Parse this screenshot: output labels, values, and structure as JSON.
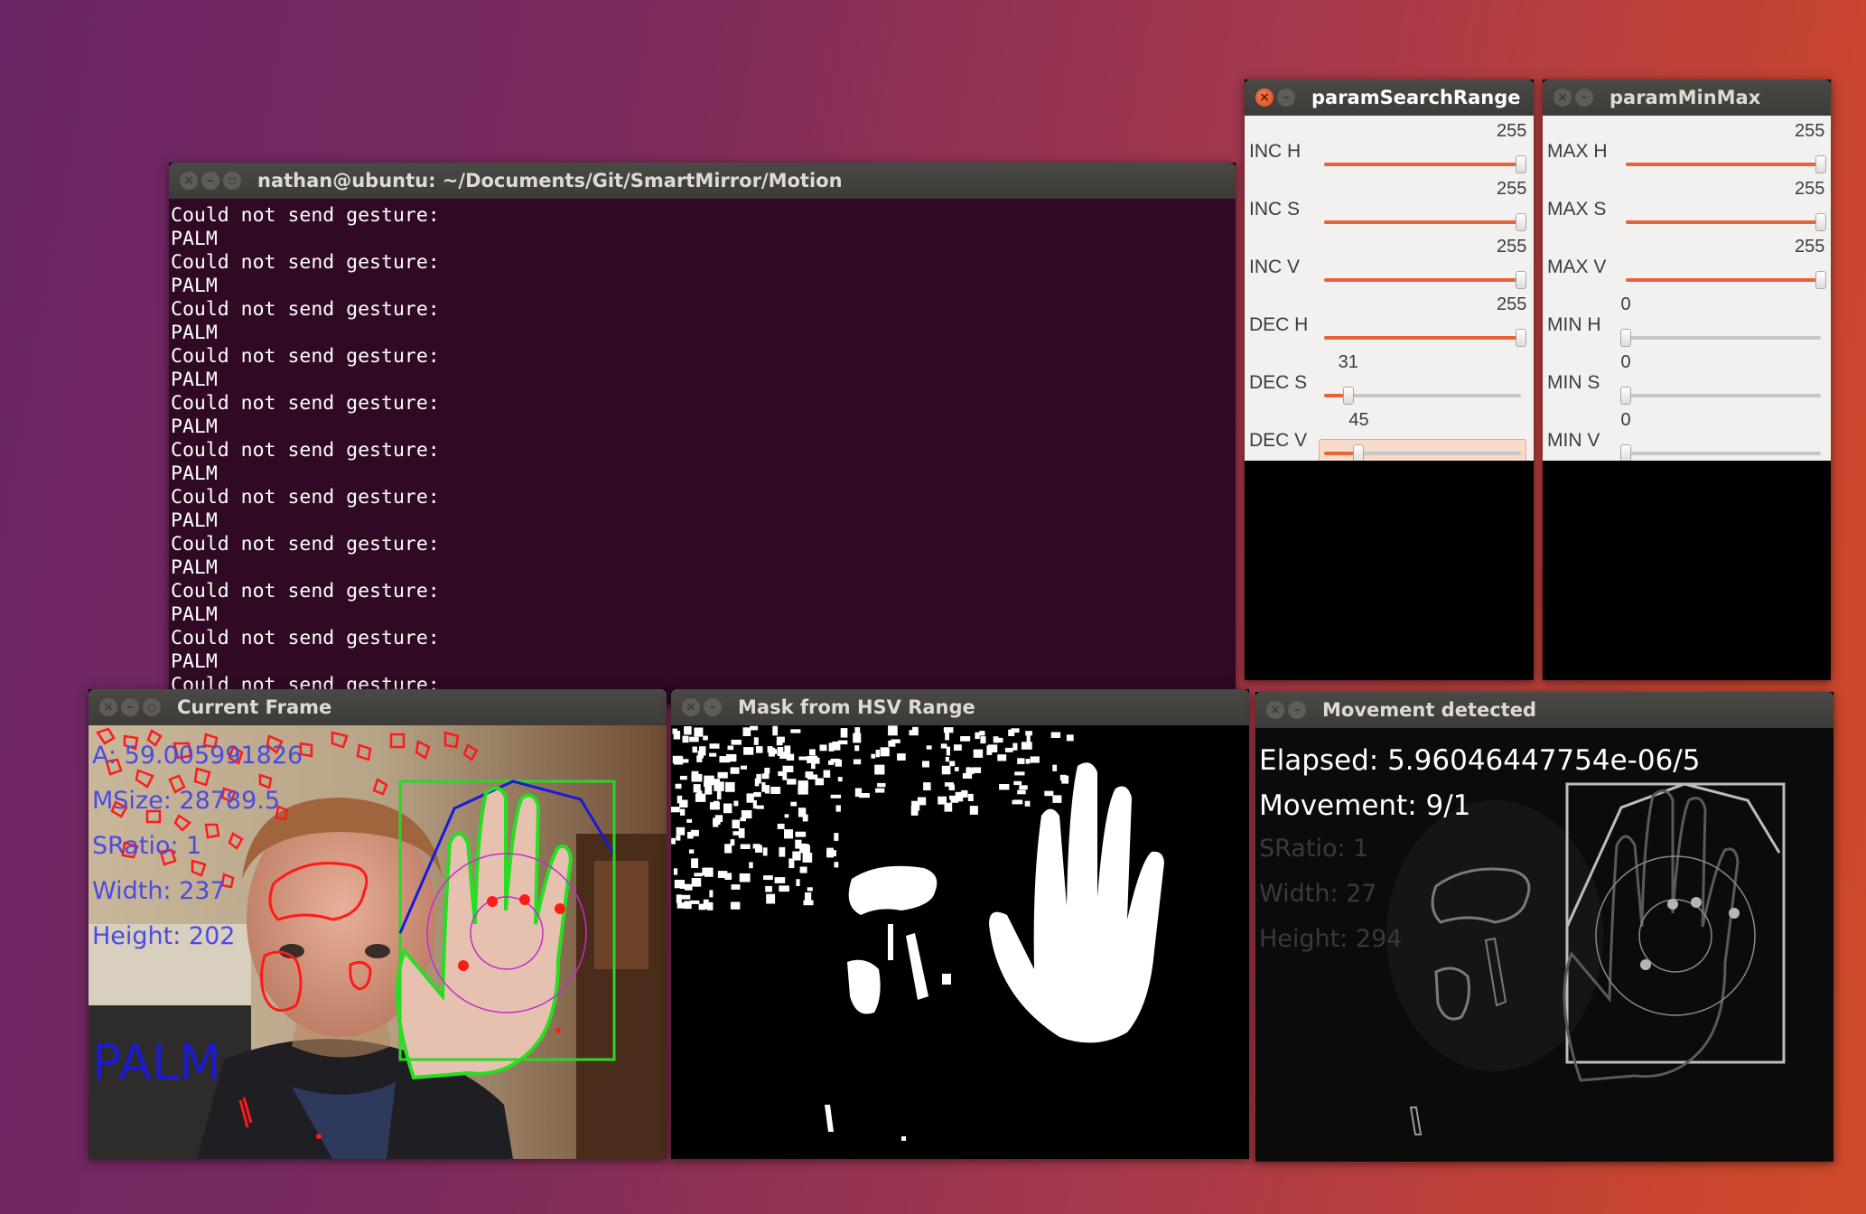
{
  "terminal": {
    "title": "nathan@ubuntu: ~/Documents/Git/SmartMirror/Motion",
    "lines": [
      "Could not send gesture:",
      "PALM",
      "Could not send gesture:",
      "PALM",
      "Could not send gesture:",
      "PALM",
      "Could not send gesture:",
      "PALM",
      "Could not send gesture:",
      "PALM",
      "Could not send gesture:",
      "PALM",
      "Could not send gesture:",
      "PALM",
      "Could not send gesture:",
      "PALM",
      "Could not send gesture:",
      "PALM",
      "Could not send gesture:",
      "PALM",
      "Could not send gesture:"
    ]
  },
  "param_search_range": {
    "title": "paramSearchRange",
    "sliders": [
      {
        "label": "INC H",
        "value": "255",
        "fraction": 1.0
      },
      {
        "label": "INC S",
        "value": "255",
        "fraction": 1.0
      },
      {
        "label": "INC V",
        "value": "255",
        "fraction": 1.0
      },
      {
        "label": "DEC H",
        "value": "255",
        "fraction": 1.0
      },
      {
        "label": "DEC S",
        "value": "31",
        "fraction": 0.122
      },
      {
        "label": "DEC V",
        "value": "45",
        "fraction": 0.176
      }
    ]
  },
  "param_min_max": {
    "title": "paramMinMax",
    "sliders": [
      {
        "label": "MAX H",
        "value": "255",
        "fraction": 1.0
      },
      {
        "label": "MAX S",
        "value": "255",
        "fraction": 1.0
      },
      {
        "label": "MAX V",
        "value": "255",
        "fraction": 1.0
      },
      {
        "label": "MIN H",
        "value": "0",
        "fraction": 0.0
      },
      {
        "label": "MIN S",
        "value": "0",
        "fraction": 0.0
      },
      {
        "label": "MIN V",
        "value": "0",
        "fraction": 0.0
      }
    ]
  },
  "current_frame": {
    "title": "Current Frame",
    "overlay": {
      "area": "A: 59.005991826",
      "msize": "MSize: 28789.5",
      "sratio": "SRatio: 1",
      "width": "Width: 237",
      "height": "Height: 202",
      "gesture": "PALM"
    }
  },
  "mask_window": {
    "title": "Mask from HSV Range"
  },
  "movement_window": {
    "title": "Movement detected",
    "elapsed": "Elapsed: 5.96046447754e-06/5",
    "movement": "Movement: 9/1",
    "sratio": "SRatio: 1",
    "width": "Width: 27",
    "height": "Height: 294"
  },
  "colors": {
    "terminal_bg": "#300a24",
    "slider_fill": "#e9633a",
    "titlebar": "#3c3b37",
    "close_button_active": "#df4b16"
  }
}
